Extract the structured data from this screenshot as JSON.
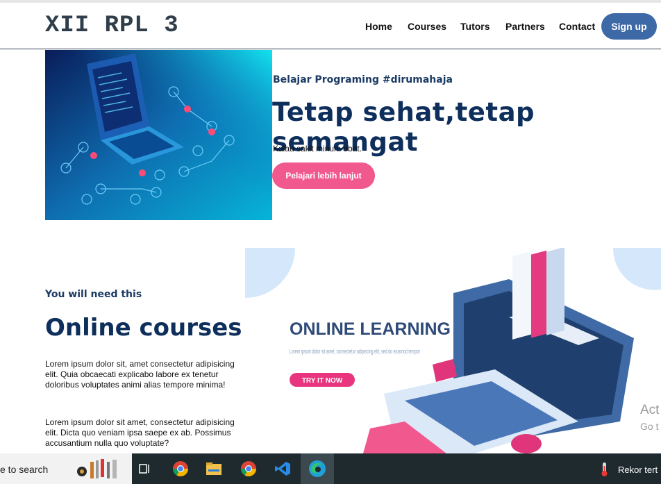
{
  "brand": "XII RPL 3",
  "nav": {
    "links": [
      "Home",
      "Courses",
      "Tutors",
      "Partners",
      "Contact"
    ],
    "signup": "Sign up"
  },
  "hero": {
    "subtitle": "Belajar Programing #dirumahaja",
    "title": "Tetap sehat,tetap semangat",
    "text": "Kalau sakit minum obat.",
    "button": "Pelajari lebih lanjut"
  },
  "courses": {
    "subtitle": "You will need this",
    "title": "Online courses",
    "paragraph1": "Lorem ipsum dolor sit, amet consectetur adipisicing elit. Quia obcaecati explicabo labore ex tenetur doloribus voluptates animi alias tempore minima!",
    "paragraph2": "Lorem ipsum dolor sit amet, consectetur adipisicing elit. Dicta quo veniam ipsa saepe ex ab. Possimus accusantium nulla quo voluptate?"
  },
  "illustration": {
    "heading": "ONLINE LEARNING",
    "body": "Lorem ipsum dolor sit amet, consectetur adipiscing elit, sed do eiusmod tempor",
    "button": "TRY IT NOW"
  },
  "watermark": {
    "line1": "Act",
    "line2": "Go t"
  },
  "taskbar": {
    "search": "e to search",
    "weather": "Rekor tert",
    "icons": [
      "tools-icon",
      "task-view-icon",
      "chrome-icon",
      "file-explorer-icon",
      "chrome-icon",
      "vscode-icon",
      "edge-icon"
    ]
  },
  "colors": {
    "navy": "#0e2f5c",
    "pink": "#f1588d",
    "blue_button": "#3d69a7"
  }
}
